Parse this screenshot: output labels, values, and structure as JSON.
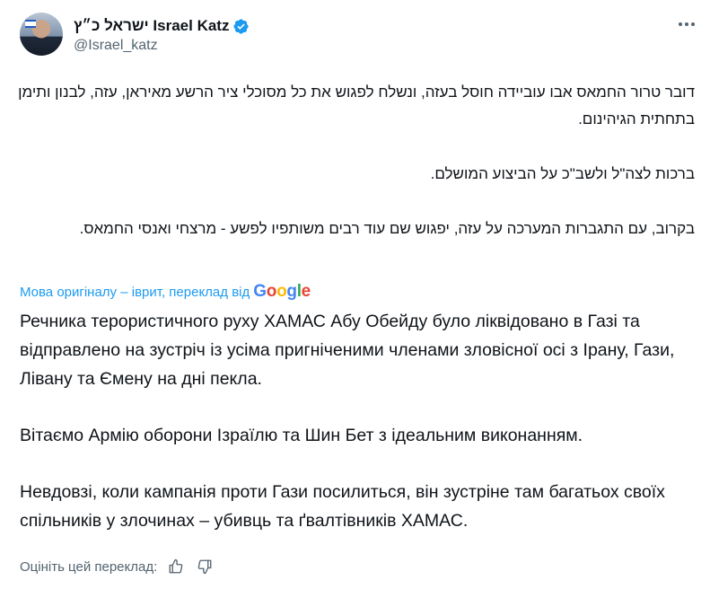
{
  "author": {
    "display_name": "ישראל כ״ץ Israel Katz",
    "handle": "@Israel_katz",
    "verified_icon": "verified-badge-icon"
  },
  "menu": {
    "icon": "more-horizontal-icon"
  },
  "original_text": {
    "lang": "he",
    "paragraphs": [
      "דובר טרור החמאס אבו עוביידה חוסל בעזה, ונשלח לפגוש את כל מסוכלי ציר הרשע מאיראן, עזה, לבנון ותימן בתחתית הגיהינום.",
      "ברכות לצה\"ל ולשב\"כ על הביצוע המושלם.",
      "בקרוב, עם התגברות המערכה על עזה, יפגוש שם עוד רבים משותפיו לפשע - מרצחי ואנסי החמאס."
    ]
  },
  "translation_note": {
    "text": "Мова оригіналу – іврит, переклад від",
    "provider": "Google"
  },
  "translated_text": {
    "lang": "uk",
    "paragraphs": [
      "Речника терористичного руху ХАМАС Абу Обейду було ліквідовано в Газі та відправлено на зустріч із усіма пригніченими членами зловісної осі з Ірану, Гази, Лівану та Ємену на дні пекла.",
      "Вітаємо Армію оборони Ізраїлю та Шин Бет з ідеальним виконанням.",
      "Невдовзі, коли кампанія проти Гази посилиться, він зустріне там багатьох своїх спільників у злочинах – убивць та ґвалтівників ХАМАС."
    ]
  },
  "rating": {
    "label": "Оцініть цей переклад:",
    "icons": [
      "thumbs-up-icon",
      "thumbs-down-icon"
    ]
  },
  "colors": {
    "link": "#1d9bf0",
    "text": "#0f1419",
    "secondary": "#536471",
    "verified": "#1d9bf0"
  }
}
